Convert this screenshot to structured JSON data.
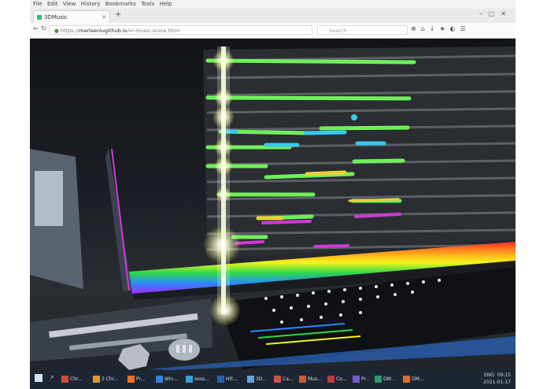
{
  "browser": {
    "menu": [
      "File",
      "Edit",
      "View",
      "History",
      "Bookmarks",
      "Tools",
      "Help"
    ],
    "tab_title": "3DMusic",
    "url_prefix": "https://",
    "url_host": "marleeniugithub.io",
    "url_rest": "/vr-music-score.html",
    "search_placeholder": "Search"
  },
  "taskbar": {
    "items": [
      {
        "label": "Chr...",
        "color": "#d04b3a"
      },
      {
        "label": "3 Chr...",
        "color": "#d99a2a"
      },
      {
        "label": "Pr...",
        "color": "#e8732a"
      },
      {
        "label": "Win...",
        "color": "#3a7fd6"
      },
      {
        "label": "sess...",
        "color": "#3a9ad6"
      },
      {
        "label": "Htt...",
        "color": "#2b5fb0"
      },
      {
        "label": "3D...",
        "color": "#6aa0d8"
      },
      {
        "label": "Ca...",
        "color": "#c8544a"
      },
      {
        "label": "Mus...",
        "color": "#d05a32"
      },
      {
        "label": "Co...",
        "color": "#c03a3a"
      },
      {
        "label": "Pr...",
        "color": "#7a5ad0"
      },
      {
        "label": "DM...",
        "color": "#2a9a6a"
      },
      {
        "label": "DM...",
        "color": "#e06a2a"
      }
    ],
    "tray_time": "09:15",
    "tray_date": "2021-01-17",
    "tray_lang": "ENG"
  }
}
